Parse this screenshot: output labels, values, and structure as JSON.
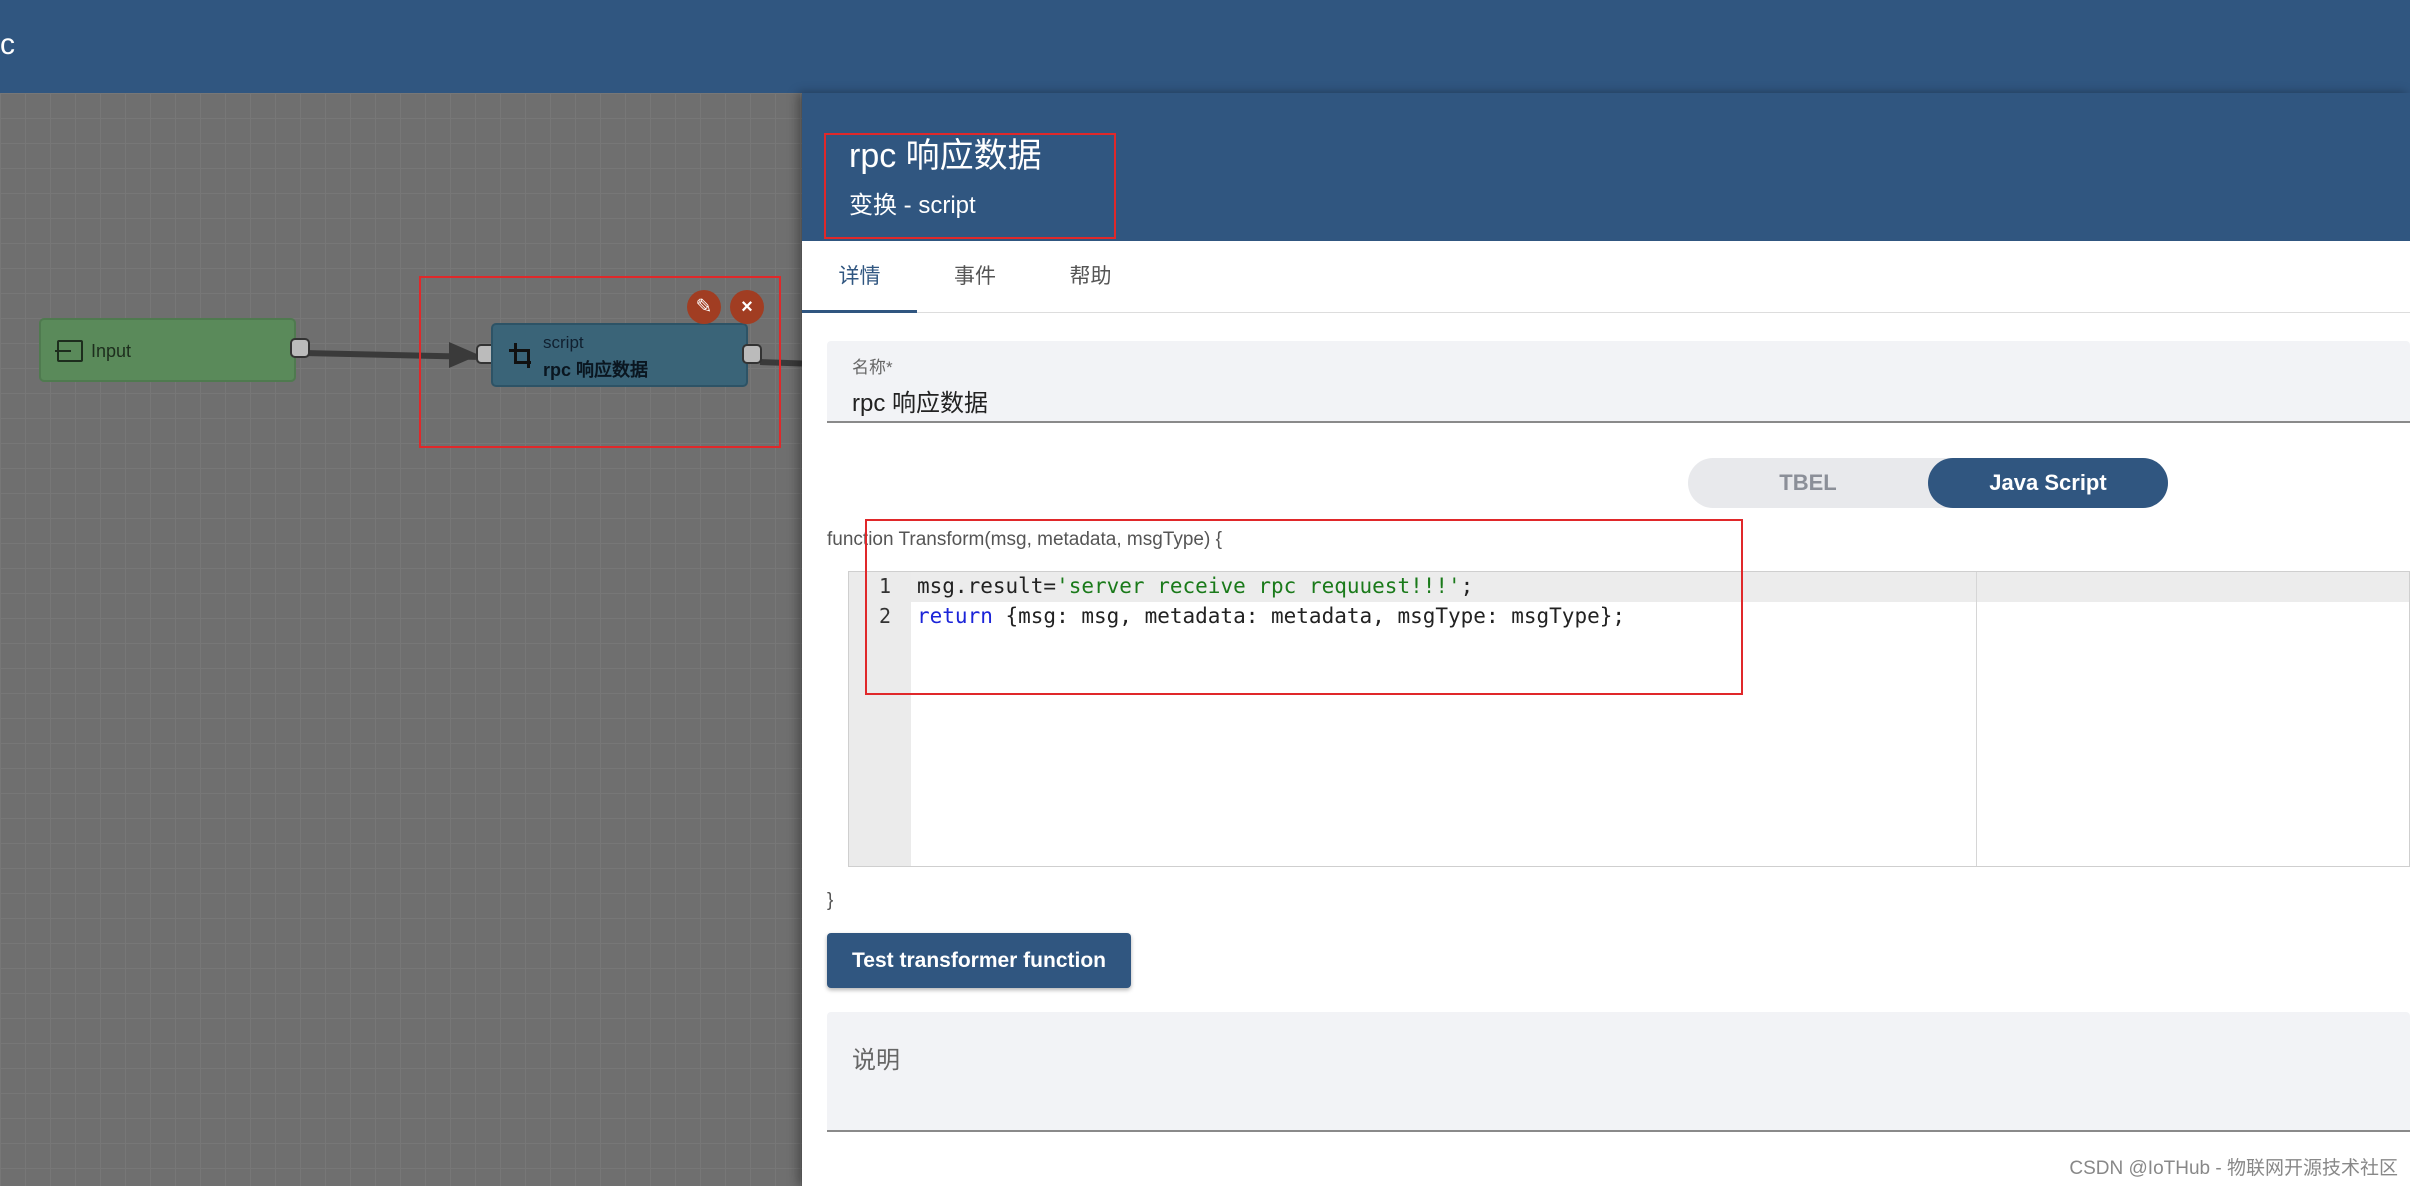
{
  "app": {
    "title_fragment": "c"
  },
  "canvas": {
    "nodes": [
      {
        "type": "input",
        "label": "Input",
        "icon": "input-icon"
      },
      {
        "type": "script",
        "type_label": "script",
        "name": "rpc 响应数据",
        "icon": "transform-icon"
      }
    ],
    "node_actions": {
      "edit_icon": "pencil-icon",
      "delete_icon": "close-icon"
    }
  },
  "panel": {
    "title": "rpc 响应数据",
    "subtitle": "变换 - script",
    "tabs": [
      {
        "label": "详情",
        "active": true
      },
      {
        "label": "事件",
        "active": false
      },
      {
        "label": "帮助",
        "active": false
      }
    ],
    "name_field": {
      "label": "名称*",
      "value": "rpc 响应数据"
    },
    "language_toggle": {
      "options": [
        "TBEL",
        "Java Script"
      ],
      "selected": "Java Script"
    },
    "function_signature": "function Transform(msg, metadata, msgType) {",
    "code": {
      "line_numbers": [
        "1",
        "2"
      ],
      "line1_prefix": "msg.result=",
      "line1_string": "'server receive rpc requuest!!!'",
      "line1_suffix": ";",
      "line2_keyword": "return",
      "line2_rest": " {msg: msg, metadata: metadata, msgType: msgType};"
    },
    "function_end": "}",
    "test_button": "Test transformer function",
    "description_label": "说明"
  },
  "watermark": "CSDN @IoTHub - 物联网开源技术社区",
  "colors": {
    "primary": "#305680",
    "highlight_box": "#e0282a",
    "node_input": "#5a8a5a",
    "node_script": "#3a6478"
  }
}
